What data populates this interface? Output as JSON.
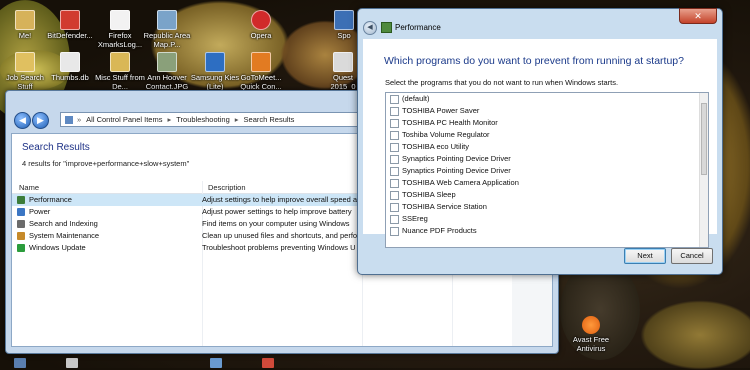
{
  "desktop": {
    "icons": [
      {
        "label": "Me!"
      },
      {
        "label": "BitDefender..."
      },
      {
        "label": "Firefox XmarksLog..."
      },
      {
        "label": "Republic Area Map.P..."
      },
      {
        "label": "Opera"
      },
      {
        "label": "Spo"
      },
      {
        "label": "Job Search Stuff"
      },
      {
        "label": "Thumbs.db"
      },
      {
        "label": "Misc Stuff from De..."
      },
      {
        "label": "Ann Hoover Contact.JPG"
      },
      {
        "label": "Samsung Kies (Lite)"
      },
      {
        "label": "GoToMeet... Quick Con..."
      },
      {
        "label": "Quest 2015_0"
      },
      {
        "label": "Avast Free Antivirus"
      }
    ]
  },
  "explorer": {
    "address": [
      "All Control Panel Items",
      "Troubleshooting",
      "Search Results"
    ],
    "title": "Search Results",
    "result_count": "4 results for \"improve+performance+slow+system\"",
    "columns": {
      "name": "Name",
      "description": "Description"
    },
    "rows": [
      {
        "name": "Performance",
        "description": "Adjust settings to help improve overall speed a",
        "color": "#3c7d3a"
      },
      {
        "name": "Power",
        "description": "Adjust power settings to help improve battery",
        "color": "#3b76c4"
      },
      {
        "name": "Search and Indexing",
        "description": "Find items on your computer using Windows",
        "color": "#6b6b6b"
      },
      {
        "name": "System Maintenance",
        "description": "Clean up unused files and shortcuts, and perfo",
        "color": "#c68a2a"
      },
      {
        "name": "Windows Update",
        "description": "Troubleshoot problems preventing Windows U",
        "color": "#2b9c3c"
      }
    ]
  },
  "dialog": {
    "title": "Performance",
    "question": "Which programs do you want to prevent from running at startup?",
    "subtitle": "Select the programs that you do not want to run when Windows starts.",
    "programs": [
      "(default)",
      "TOSHIBA Power Saver",
      "TOSHIBA PC Health Monitor",
      "Toshiba Volume Regulator",
      "TOSHIBA eco Utility",
      "Synaptics Pointing Device Driver",
      "Synaptics Pointing Device Driver",
      "TOSHIBA Web Camera Application",
      "TOSHIBA Sleep",
      "TOSHIBA Service Station",
      "SSEreg",
      "Nuance PDF Products"
    ],
    "buttons": {
      "next": "Next",
      "cancel": "Cancel"
    }
  }
}
